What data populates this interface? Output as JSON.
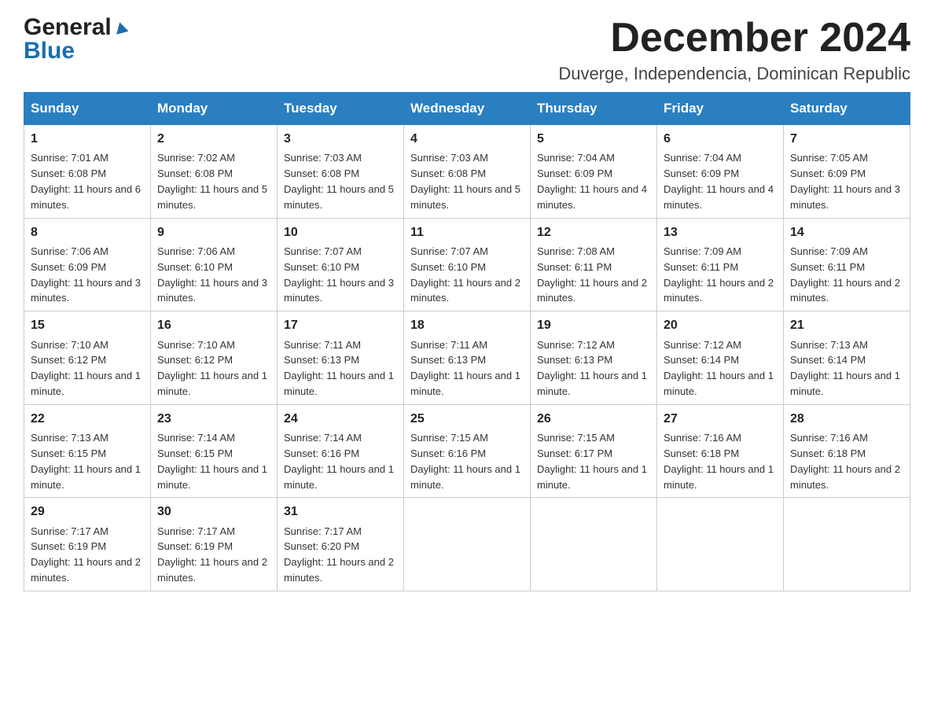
{
  "logo": {
    "general": "General",
    "blue": "Blue"
  },
  "title": {
    "month_year": "December 2024",
    "location": "Duverge, Independencia, Dominican Republic"
  },
  "days_of_week": [
    "Sunday",
    "Monday",
    "Tuesday",
    "Wednesday",
    "Thursday",
    "Friday",
    "Saturday"
  ],
  "weeks": [
    [
      {
        "day": "1",
        "sunrise": "7:01 AM",
        "sunset": "6:08 PM",
        "daylight": "11 hours and 6 minutes."
      },
      {
        "day": "2",
        "sunrise": "7:02 AM",
        "sunset": "6:08 PM",
        "daylight": "11 hours and 5 minutes."
      },
      {
        "day": "3",
        "sunrise": "7:03 AM",
        "sunset": "6:08 PM",
        "daylight": "11 hours and 5 minutes."
      },
      {
        "day": "4",
        "sunrise": "7:03 AM",
        "sunset": "6:08 PM",
        "daylight": "11 hours and 5 minutes."
      },
      {
        "day": "5",
        "sunrise": "7:04 AM",
        "sunset": "6:09 PM",
        "daylight": "11 hours and 4 minutes."
      },
      {
        "day": "6",
        "sunrise": "7:04 AM",
        "sunset": "6:09 PM",
        "daylight": "11 hours and 4 minutes."
      },
      {
        "day": "7",
        "sunrise": "7:05 AM",
        "sunset": "6:09 PM",
        "daylight": "11 hours and 3 minutes."
      }
    ],
    [
      {
        "day": "8",
        "sunrise": "7:06 AM",
        "sunset": "6:09 PM",
        "daylight": "11 hours and 3 minutes."
      },
      {
        "day": "9",
        "sunrise": "7:06 AM",
        "sunset": "6:10 PM",
        "daylight": "11 hours and 3 minutes."
      },
      {
        "day": "10",
        "sunrise": "7:07 AM",
        "sunset": "6:10 PM",
        "daylight": "11 hours and 3 minutes."
      },
      {
        "day": "11",
        "sunrise": "7:07 AM",
        "sunset": "6:10 PM",
        "daylight": "11 hours and 2 minutes."
      },
      {
        "day": "12",
        "sunrise": "7:08 AM",
        "sunset": "6:11 PM",
        "daylight": "11 hours and 2 minutes."
      },
      {
        "day": "13",
        "sunrise": "7:09 AM",
        "sunset": "6:11 PM",
        "daylight": "11 hours and 2 minutes."
      },
      {
        "day": "14",
        "sunrise": "7:09 AM",
        "sunset": "6:11 PM",
        "daylight": "11 hours and 2 minutes."
      }
    ],
    [
      {
        "day": "15",
        "sunrise": "7:10 AM",
        "sunset": "6:12 PM",
        "daylight": "11 hours and 1 minute."
      },
      {
        "day": "16",
        "sunrise": "7:10 AM",
        "sunset": "6:12 PM",
        "daylight": "11 hours and 1 minute."
      },
      {
        "day": "17",
        "sunrise": "7:11 AM",
        "sunset": "6:13 PM",
        "daylight": "11 hours and 1 minute."
      },
      {
        "day": "18",
        "sunrise": "7:11 AM",
        "sunset": "6:13 PM",
        "daylight": "11 hours and 1 minute."
      },
      {
        "day": "19",
        "sunrise": "7:12 AM",
        "sunset": "6:13 PM",
        "daylight": "11 hours and 1 minute."
      },
      {
        "day": "20",
        "sunrise": "7:12 AM",
        "sunset": "6:14 PM",
        "daylight": "11 hours and 1 minute."
      },
      {
        "day": "21",
        "sunrise": "7:13 AM",
        "sunset": "6:14 PM",
        "daylight": "11 hours and 1 minute."
      }
    ],
    [
      {
        "day": "22",
        "sunrise": "7:13 AM",
        "sunset": "6:15 PM",
        "daylight": "11 hours and 1 minute."
      },
      {
        "day": "23",
        "sunrise": "7:14 AM",
        "sunset": "6:15 PM",
        "daylight": "11 hours and 1 minute."
      },
      {
        "day": "24",
        "sunrise": "7:14 AM",
        "sunset": "6:16 PM",
        "daylight": "11 hours and 1 minute."
      },
      {
        "day": "25",
        "sunrise": "7:15 AM",
        "sunset": "6:16 PM",
        "daylight": "11 hours and 1 minute."
      },
      {
        "day": "26",
        "sunrise": "7:15 AM",
        "sunset": "6:17 PM",
        "daylight": "11 hours and 1 minute."
      },
      {
        "day": "27",
        "sunrise": "7:16 AM",
        "sunset": "6:18 PM",
        "daylight": "11 hours and 1 minute."
      },
      {
        "day": "28",
        "sunrise": "7:16 AM",
        "sunset": "6:18 PM",
        "daylight": "11 hours and 2 minutes."
      }
    ],
    [
      {
        "day": "29",
        "sunrise": "7:17 AM",
        "sunset": "6:19 PM",
        "daylight": "11 hours and 2 minutes."
      },
      {
        "day": "30",
        "sunrise": "7:17 AM",
        "sunset": "6:19 PM",
        "daylight": "11 hours and 2 minutes."
      },
      {
        "day": "31",
        "sunrise": "7:17 AM",
        "sunset": "6:20 PM",
        "daylight": "11 hours and 2 minutes."
      },
      null,
      null,
      null,
      null
    ]
  ],
  "labels": {
    "sunrise": "Sunrise:",
    "sunset": "Sunset:",
    "daylight": "Daylight:"
  }
}
